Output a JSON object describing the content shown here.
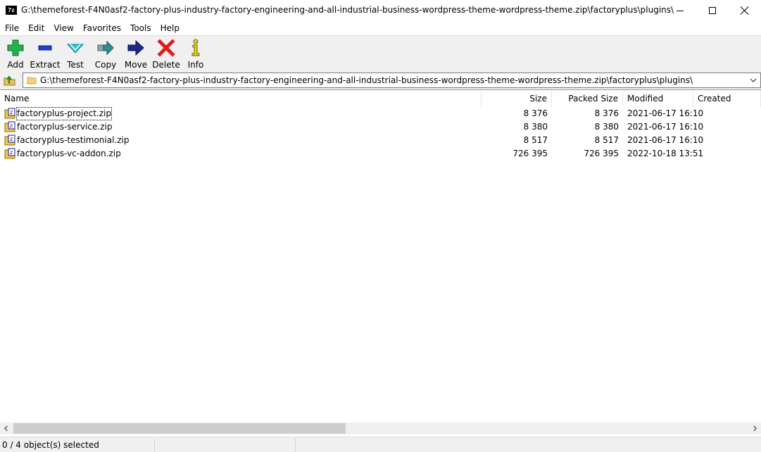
{
  "window": {
    "app_icon_text": "7z",
    "title": "G:\\themeforest-F4N0asf2-factory-plus-industry-factory-engineering-and-all-industrial-business-wordpress-theme-wordpress-theme.zip\\factoryplus\\plugins\\"
  },
  "menu": [
    "File",
    "Edit",
    "View",
    "Favorites",
    "Tools",
    "Help"
  ],
  "toolbar": {
    "add": "Add",
    "extract": "Extract",
    "test": "Test",
    "copy": "Copy",
    "move": "Move",
    "delete": "Delete",
    "info": "Info"
  },
  "address": {
    "path": "G:\\themeforest-F4N0asf2-factory-plus-industry-factory-engineering-and-all-industrial-business-wordpress-theme-wordpress-theme.zip\\factoryplus\\plugins\\"
  },
  "columns": {
    "name": "Name",
    "size": "Size",
    "packed_size": "Packed Size",
    "modified": "Modified",
    "created": "Created"
  },
  "files": [
    {
      "name": "factoryplus-project.zip",
      "size": "8 376",
      "packed_size": "8 376",
      "modified": "2021-06-17 16:10",
      "created": ""
    },
    {
      "name": "factoryplus-service.zip",
      "size": "8 380",
      "packed_size": "8 380",
      "modified": "2021-06-17 16:10",
      "created": ""
    },
    {
      "name": "factoryplus-testimonial.zip",
      "size": "8 517",
      "packed_size": "8 517",
      "modified": "2021-06-17 16:10",
      "created": ""
    },
    {
      "name": "factoryplus-vc-addon.zip",
      "size": "726 395",
      "packed_size": "726 395",
      "modified": "2022-10-18 13:51",
      "created": ""
    }
  ],
  "status": {
    "selection": "0 / 4 object(s) selected",
    "segment2": "",
    "segment3": ""
  },
  "colors": {
    "toolbar_bg": "#f0f0f0",
    "add_icon": "#22b14c",
    "extract_icon": "#1f3fd1",
    "test_icon": "#2ec4d6",
    "copy_icon": "#2a8f8f",
    "move_icon": "#1a2a8a",
    "delete_icon": "#e01b1b",
    "info_icon": "#e8d21a"
  }
}
